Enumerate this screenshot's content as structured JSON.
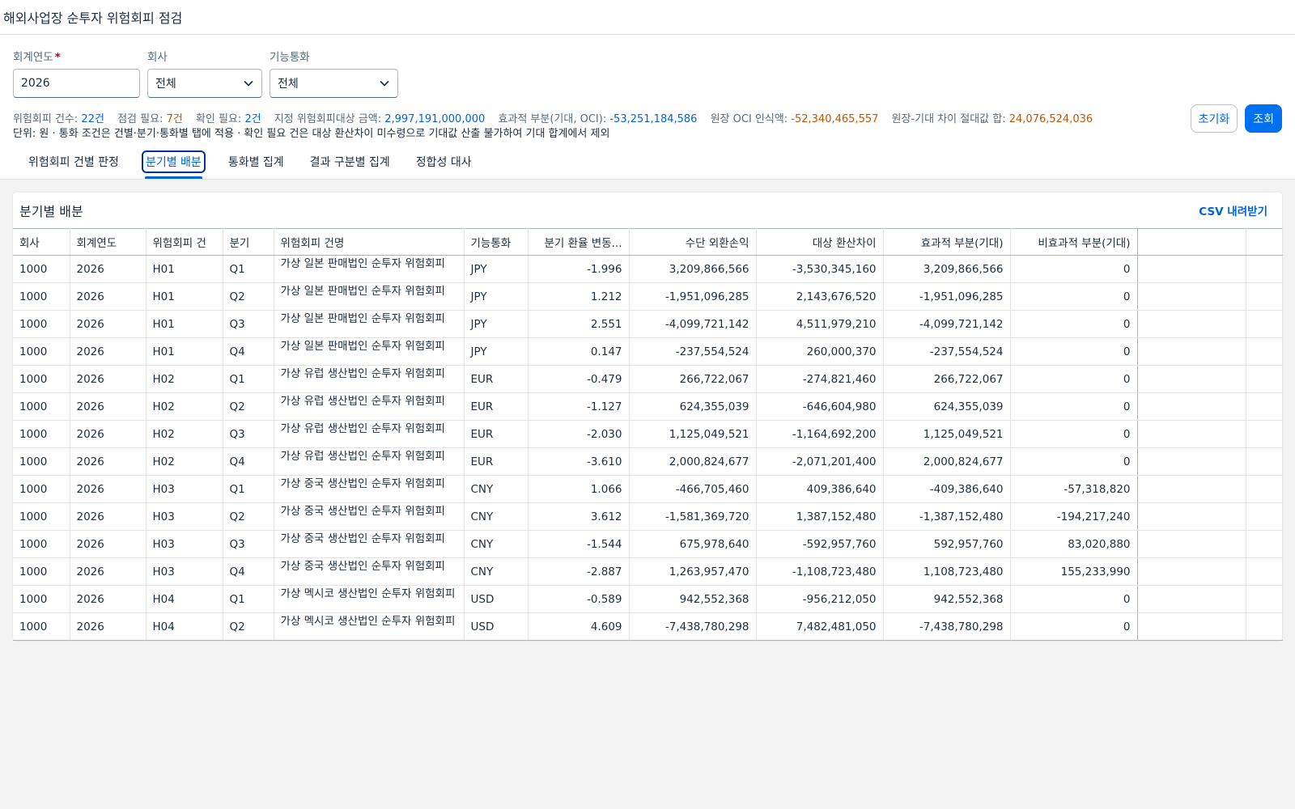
{
  "app": {
    "title": "해외사업장 순투자 위험회피 점검"
  },
  "filters": {
    "year": {
      "label": "회계연도",
      "required_mark": "*",
      "value": "2026"
    },
    "company": {
      "label": "회사",
      "value": "전체"
    },
    "currency": {
      "label": "기능통화",
      "value": "전체"
    }
  },
  "actions": {
    "reset_label": "초기화",
    "search_label": "조회"
  },
  "summary": {
    "items": [
      {
        "label": "위험회피 건수:",
        "value": "22건",
        "color": "blue"
      },
      {
        "label": "점검 필요:",
        "value": "7건",
        "color": "orange"
      },
      {
        "label": "확인 필요:",
        "value": "2건",
        "color": "blue"
      },
      {
        "label": "지정 위험회피대상 금액:",
        "value": "2,997,191,000,000",
        "color": "blue"
      },
      {
        "label": "효과적 부분(기대, OCI):",
        "value": "-53,251,184,586",
        "color": "blue"
      },
      {
        "label": "원장 OCI 인식액:",
        "value": "-52,340,465,557",
        "color": "orange"
      },
      {
        "label": "원장-기대 차이 절대값 합:",
        "value": "24,076,524,036",
        "color": "orange"
      }
    ],
    "note": "단위: 원 · 통화 조건은 건별·분기·통화별 탭에 적용 · 확인 필요 건은 대상 환산차이 미수령으로 기대값 산출 불가하여 기대 합계에서 제외"
  },
  "tabs": [
    {
      "label": "위험회피 건별 판정",
      "active": false
    },
    {
      "label": "분기별 배분",
      "active": true
    },
    {
      "label": "통화별 집계",
      "active": false
    },
    {
      "label": "결과 구분별 집계",
      "active": false
    },
    {
      "label": "정합성 대사",
      "active": false
    }
  ],
  "panel": {
    "title": "분기별 배분",
    "csv_label": "CSV 내려받기"
  },
  "table": {
    "columns": [
      "회사",
      "회계연도",
      "위험회피 건",
      "분기",
      "위험회피 건명",
      "기능통화",
      "분기 환율 변동...",
      "수단 외환손익",
      "대상 환산차이",
      "효과적 부분(기대)",
      "비효과적 부분(기대)"
    ],
    "rows": [
      [
        "1000",
        "2026",
        "H01",
        "Q1",
        "가상 일본 판매법인 순투자 위험회피",
        "JPY",
        "-1.996",
        "3,209,866,566",
        "-3,530,345,160",
        "3,209,866,566",
        "0"
      ],
      [
        "1000",
        "2026",
        "H01",
        "Q2",
        "가상 일본 판매법인 순투자 위험회피",
        "JPY",
        "1.212",
        "-1,951,096,285",
        "2,143,676,520",
        "-1,951,096,285",
        "0"
      ],
      [
        "1000",
        "2026",
        "H01",
        "Q3",
        "가상 일본 판매법인 순투자 위험회피",
        "JPY",
        "2.551",
        "-4,099,721,142",
        "4,511,979,210",
        "-4,099,721,142",
        "0"
      ],
      [
        "1000",
        "2026",
        "H01",
        "Q4",
        "가상 일본 판매법인 순투자 위험회피",
        "JPY",
        "0.147",
        "-237,554,524",
        "260,000,370",
        "-237,554,524",
        "0"
      ],
      [
        "1000",
        "2026",
        "H02",
        "Q1",
        "가상 유럽 생산법인 순투자 위험회피",
        "EUR",
        "-0.479",
        "266,722,067",
        "-274,821,460",
        "266,722,067",
        "0"
      ],
      [
        "1000",
        "2026",
        "H02",
        "Q2",
        "가상 유럽 생산법인 순투자 위험회피",
        "EUR",
        "-1.127",
        "624,355,039",
        "-646,604,980",
        "624,355,039",
        "0"
      ],
      [
        "1000",
        "2026",
        "H02",
        "Q3",
        "가상 유럽 생산법인 순투자 위험회피",
        "EUR",
        "-2.030",
        "1,125,049,521",
        "-1,164,692,200",
        "1,125,049,521",
        "0"
      ],
      [
        "1000",
        "2026",
        "H02",
        "Q4",
        "가상 유럽 생산법인 순투자 위험회피",
        "EUR",
        "-3.610",
        "2,000,824,677",
        "-2,071,201,400",
        "2,000,824,677",
        "0"
      ],
      [
        "1000",
        "2026",
        "H03",
        "Q1",
        "가상 중국 생산법인 순투자 위험회피",
        "CNY",
        "1.066",
        "-466,705,460",
        "409,386,640",
        "-409,386,640",
        "-57,318,820"
      ],
      [
        "1000",
        "2026",
        "H03",
        "Q2",
        "가상 중국 생산법인 순투자 위험회피",
        "CNY",
        "3.612",
        "-1,581,369,720",
        "1,387,152,480",
        "-1,387,152,480",
        "-194,217,240"
      ],
      [
        "1000",
        "2026",
        "H03",
        "Q3",
        "가상 중국 생산법인 순투자 위험회피",
        "CNY",
        "-1.544",
        "675,978,640",
        "-592,957,760",
        "592,957,760",
        "83,020,880"
      ],
      [
        "1000",
        "2026",
        "H03",
        "Q4",
        "가상 중국 생산법인 순투자 위험회피",
        "CNY",
        "-2.887",
        "1,263,957,470",
        "-1,108,723,480",
        "1,108,723,480",
        "155,233,990"
      ],
      [
        "1000",
        "2026",
        "H04",
        "Q1",
        "가상 멕시코 생산법인 순투자 위험회피",
        "USD",
        "-0.589",
        "942,552,368",
        "-956,212,050",
        "942,552,368",
        "0"
      ],
      [
        "1000",
        "2026",
        "H04",
        "Q2",
        "가상 멕시코 생산법인 순투자 위험회피",
        "USD",
        "4.609",
        "-7,438,780,298",
        "7,482,481,050",
        "-7,438,780,298",
        "0"
      ]
    ]
  },
  "colors": {
    "blue": "#0064d9",
    "orange": "#c35500",
    "primary": "#0070f2"
  }
}
